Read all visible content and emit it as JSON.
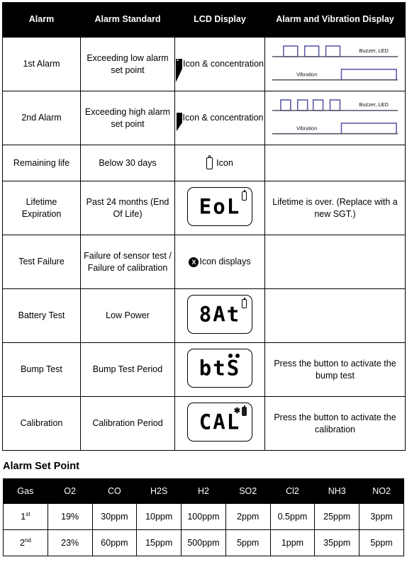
{
  "alarm_table": {
    "headers": [
      {
        "label": "Alarm"
      },
      {
        "label": "Alarm Standard"
      },
      {
        "label": "LCD Display"
      },
      {
        "label": "Alarm and Vibration Display"
      }
    ],
    "rows": [
      {
        "alarm": "1st Alarm",
        "standard": "Exceeding low alarm set point",
        "lcd_kind": "triangle1",
        "lcd_text": "Icon & concentration",
        "lcd_badge": "1",
        "display_kind": "waveform",
        "display_text": "",
        "waveform": {
          "buzzer_label": "Buzzer, LED",
          "vibration_label": "Vibration",
          "buzzer_pulses": 3,
          "vibration_pulses": 1
        }
      },
      {
        "alarm": "2nd Alarm",
        "standard": "Exceeding high alarm set point",
        "lcd_kind": "triangle2",
        "lcd_text": "Icon & concentration",
        "lcd_badge": "2",
        "display_kind": "waveform",
        "display_text": "",
        "waveform": {
          "buzzer_label": "Buzzer, LED",
          "vibration_label": "Vibration",
          "buzzer_pulses": 4,
          "vibration_pulses": 1
        }
      },
      {
        "alarm": "Remaining life",
        "standard": "Below 30 days",
        "lcd_kind": "cylinder",
        "lcd_text": "Icon",
        "lcd_badge": "",
        "display_kind": "empty",
        "display_text": ""
      },
      {
        "alarm": "Lifetime Expiration",
        "standard": "Past 24 months (End Of Life)",
        "lcd_kind": "lcd-panel",
        "lcd_text": "EoL",
        "lcd_badge": "cylinder",
        "display_kind": "text",
        "display_text": "Lifetime is over. (Replace with a new SGT.)"
      },
      {
        "alarm": "Test Failure",
        "standard": "Failure of sensor test / Failure of calibration",
        "lcd_kind": "circle-x",
        "lcd_text": "Icon displays",
        "lcd_badge": "X",
        "display_kind": "empty",
        "display_text": ""
      },
      {
        "alarm": "Battery Test",
        "standard": "Low Power",
        "lcd_kind": "lcd-panel",
        "lcd_text": "8At",
        "lcd_badge": "cylinder",
        "display_kind": "empty",
        "display_text": ""
      },
      {
        "alarm": "Bump Test",
        "standard": "Bump Test Period",
        "lcd_kind": "lcd-panel",
        "lcd_text": "btS",
        "lcd_badge": "two-dots",
        "display_kind": "text",
        "display_text": "Press the button to activate the bump test"
      },
      {
        "alarm": "Calibration",
        "standard": "Calibration Period",
        "lcd_kind": "lcd-panel",
        "lcd_text": "CAL",
        "lcd_badge": "star-cylinder",
        "display_kind": "text",
        "display_text": "Press the button to activate the calibration"
      }
    ]
  },
  "setpoint": {
    "title": "Alarm Set Point",
    "headers": [
      "Gas",
      "O2",
      "CO",
      "H2S",
      "H2",
      "SO2",
      "Cl2",
      "NH3",
      "NO2"
    ],
    "rows": [
      {
        "ordinal": "1",
        "ordinal_suffix": "st",
        "values": [
          "19%",
          "30ppm",
          "10ppm",
          "100ppm",
          "2ppm",
          "0.5ppm",
          "25ppm",
          "3ppm"
        ]
      },
      {
        "ordinal": "2",
        "ordinal_suffix": "nd",
        "values": [
          "23%",
          "60ppm",
          "15ppm",
          "500ppm",
          "5ppm",
          "1ppm",
          "35ppm",
          "5ppm"
        ]
      }
    ]
  },
  "colors": {
    "header_bg": "#000000",
    "header_fg": "#ffffff",
    "border": "#000000",
    "waveform_pulse": "#5b5ba8",
    "waveform_baseline": "#555566"
  }
}
